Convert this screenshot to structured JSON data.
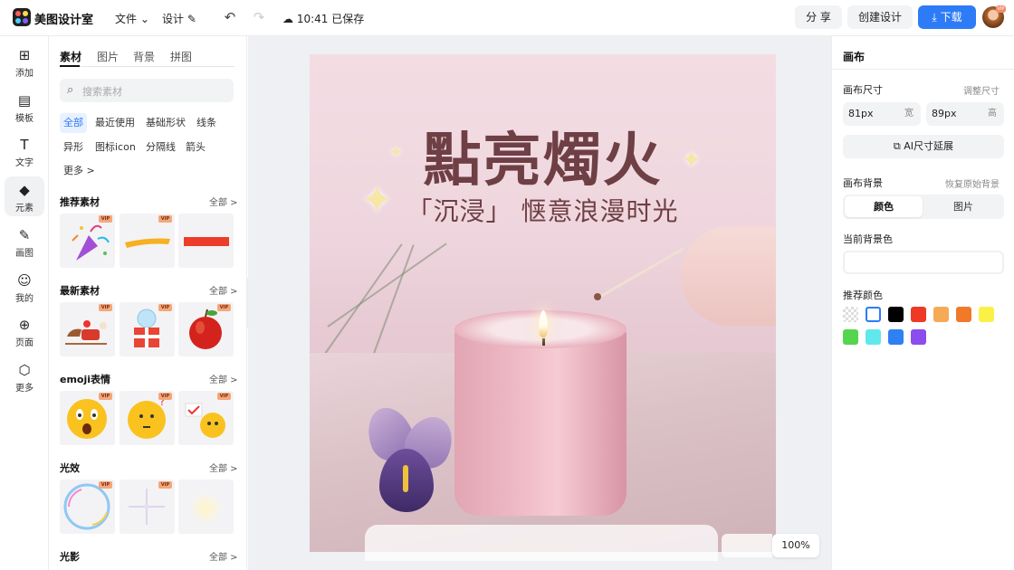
{
  "app": {
    "name": "美图设计室",
    "logo_colors": [
      "#ff5a5a",
      "#ffd84a",
      "#4ad0ff",
      "#7c5cff"
    ]
  },
  "topbar": {
    "menu_file": "文件",
    "menu_design": "设计",
    "save_status": "10:41 已保存",
    "share_label": "分 享",
    "create_label": "创建设计",
    "download_label": "下载",
    "avatar_badge": "VIP"
  },
  "leftnav": {
    "items": [
      {
        "label": "添加",
        "icon": "plus-square-icon",
        "glyph": "⊞"
      },
      {
        "label": "模板",
        "icon": "template-icon",
        "glyph": "▤"
      },
      {
        "label": "文字",
        "icon": "text-icon",
        "glyph": "T"
      },
      {
        "label": "元素",
        "icon": "elements-icon",
        "glyph": "◆"
      },
      {
        "label": "画图",
        "icon": "draw-icon",
        "glyph": "✎"
      },
      {
        "label": "我的",
        "icon": "user-icon",
        "glyph": "☺"
      },
      {
        "label": "页面",
        "icon": "page-add-icon",
        "glyph": "⊕"
      },
      {
        "label": "更多",
        "icon": "cube-icon",
        "glyph": "⬡"
      }
    ],
    "active_index": 3
  },
  "panel": {
    "tabs": [
      "素材",
      "图片",
      "背景",
      "拼图"
    ],
    "search_placeholder": "搜索素材",
    "chips": [
      "全部",
      "最近使用",
      "基础形状",
      "线条",
      "异形",
      "图标icon",
      "分隔线",
      "箭头",
      "更多 >"
    ],
    "all_label": "全部 >",
    "sections": [
      {
        "title": "推荐素材"
      },
      {
        "title": "最新素材"
      },
      {
        "title": "emoji表情"
      },
      {
        "title": "光效"
      },
      {
        "title": "光影"
      }
    ],
    "vip_badge": "VIP"
  },
  "canvas": {
    "title": "點亮燭火",
    "subtitle": "「沉浸」 惬意浪漫时光",
    "zoom": "100%"
  },
  "right": {
    "header": "画布",
    "size_label": "画布尺寸",
    "size_action": "调整尺寸",
    "width_value": "81px",
    "width_unit": "宽",
    "height_value": "89px",
    "height_unit": "高",
    "ai_extend": "AI尺寸延展",
    "bg_label": "画布背景",
    "bg_action": "恢复原始背景",
    "seg_color": "颜色",
    "seg_image": "图片",
    "current_bg_label": "当前背景色",
    "recommend_label": "推荐颜色",
    "swatches": [
      "transparent",
      "#ffffff",
      "#000000",
      "#ee3a24",
      "#f5aa55",
      "#f07a2a",
      "#fbf146",
      "#55d44f",
      "#61e8ec",
      "#2f80f2",
      "#8b4dee"
    ]
  }
}
